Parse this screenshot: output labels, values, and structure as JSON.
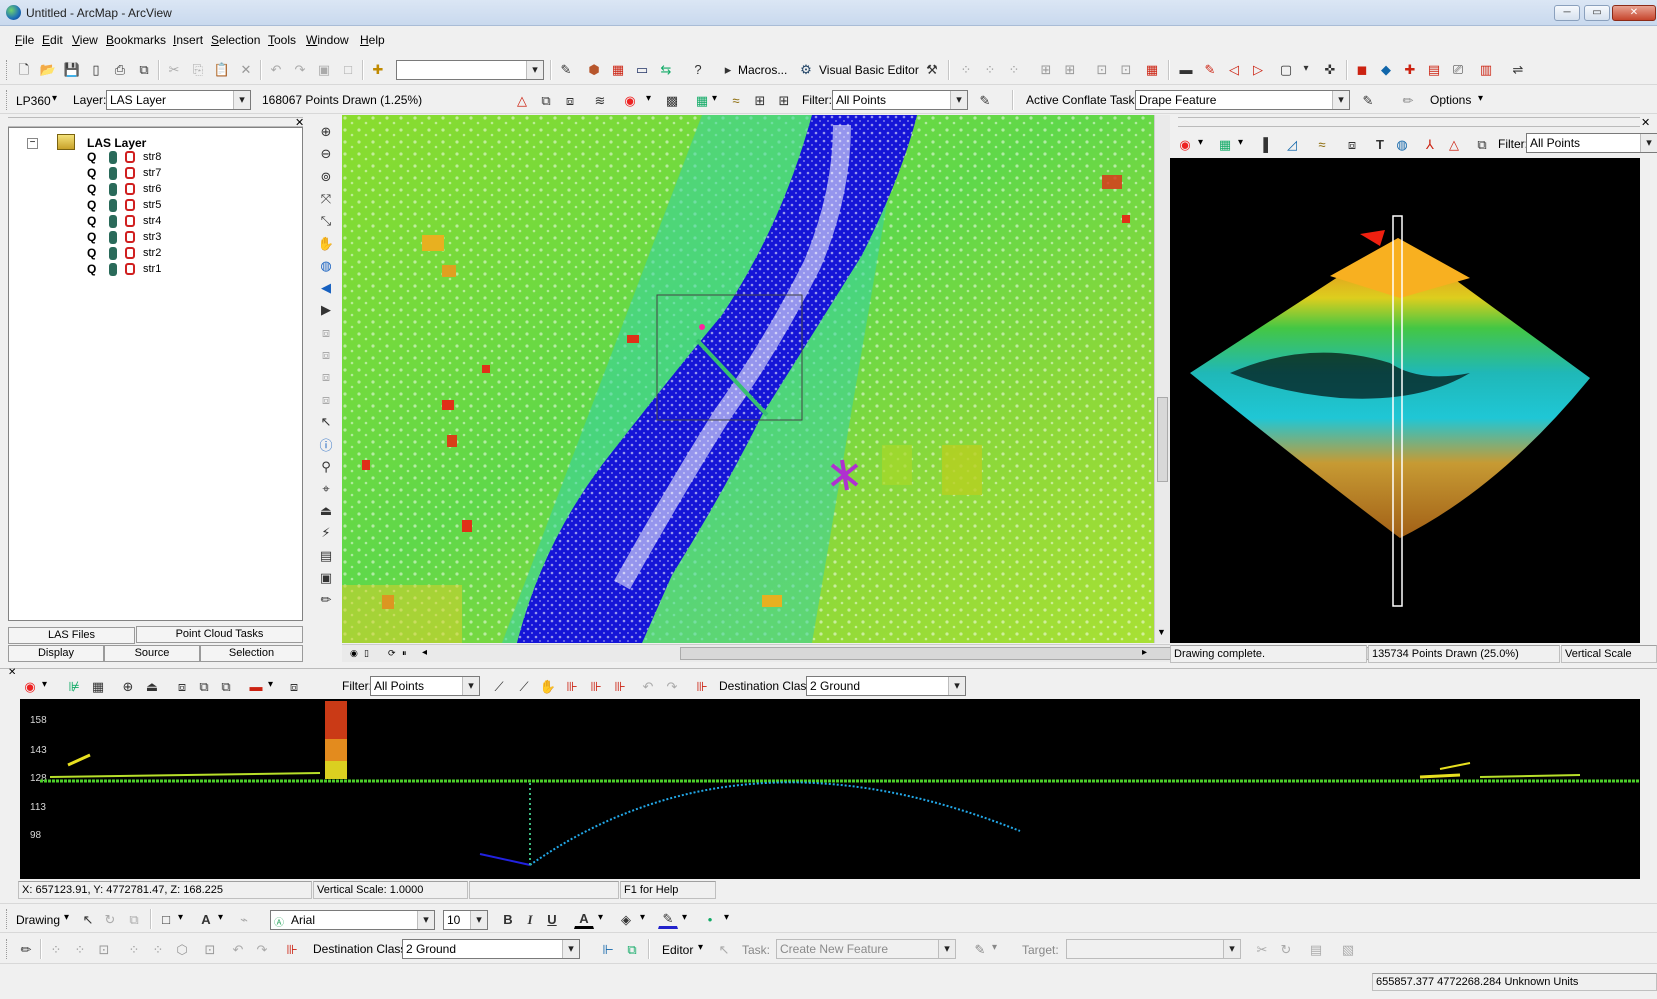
{
  "window": {
    "title": "Untitled - ArcMap - ArcView",
    "min": "0",
    "max": "1",
    "close": "r"
  },
  "menu": [
    {
      "pre": "",
      "key": "F",
      "post": "ile"
    },
    {
      "pre": "",
      "key": "E",
      "post": "dit"
    },
    {
      "pre": "",
      "key": "V",
      "post": "iew"
    },
    {
      "pre": "",
      "key": "B",
      "post": "ookmarks"
    },
    {
      "pre": "",
      "key": "I",
      "post": "nsert"
    },
    {
      "pre": "",
      "key": "S",
      "post": "election"
    },
    {
      "pre": "",
      "key": "T",
      "post": "ools"
    },
    {
      "pre": "",
      "key": "W",
      "post": "indow"
    },
    {
      "pre": "",
      "key": "H",
      "post": "elp"
    }
  ],
  "standard_toolbar": {
    "macros": "Macros...",
    "vba": "Visual Basic Editor",
    "scale_value": ""
  },
  "lp360_toolbar": {
    "lp360": "LP360",
    "layer_label": "Layer:",
    "layer_value": "LAS Layer",
    "points_drawn": "168067 Points Drawn (1.25%)",
    "filter_label": "Filter:",
    "filter_value": "All Points",
    "conflate_label": "Active Conflate Task:",
    "conflate_value": "Drape Feature",
    "options": "Options"
  },
  "toc": {
    "layer": "LAS Layer",
    "items": [
      "str8",
      "str7",
      "str6",
      "str5",
      "str4",
      "str3",
      "str2",
      "str1"
    ],
    "tabs_top": [
      "LAS Files",
      "Point Cloud Tasks"
    ],
    "tabs_bottom": [
      "Display",
      "Source",
      "Selection"
    ]
  },
  "view3d": {
    "filter_label": "Filter:",
    "filter_value": "All Points",
    "status_left": "Drawing complete.",
    "status_mid": "135734 Points Drawn (25.0%)",
    "status_right": "Vertical Scale"
  },
  "profile": {
    "filter_label": "Filter:",
    "filter_value": "All Points",
    "dest_label": "Destination Class:",
    "dest_value": "2  Ground",
    "yticks": [
      "158",
      "143",
      "128",
      "113",
      "98"
    ],
    "coord": "X: 657123.91, Y: 4772781.47, Z: 168.225",
    "vscale": "Vertical Scale: 1.0000",
    "help": "F1 for Help"
  },
  "drawing_toolbar": {
    "drawing": "Drawing",
    "font": "Arial",
    "size": "10",
    "bold": "B",
    "italic": "I",
    "underline": "U",
    "text_a": "A"
  },
  "editor_toolbar": {
    "dest_label": "Destination Class:",
    "dest_value": "2  Ground",
    "editor": "Editor",
    "task_label": "Task:",
    "task_value": "Create New Feature",
    "target_label": "Target:",
    "target_value": ""
  },
  "statusbar": {
    "coords": "655857.377  4772268.284 Unknown Units"
  },
  "colors": {
    "water": "#1a1ad8",
    "ground_green": "#7fd82a",
    "high_red": "#e0201a"
  }
}
